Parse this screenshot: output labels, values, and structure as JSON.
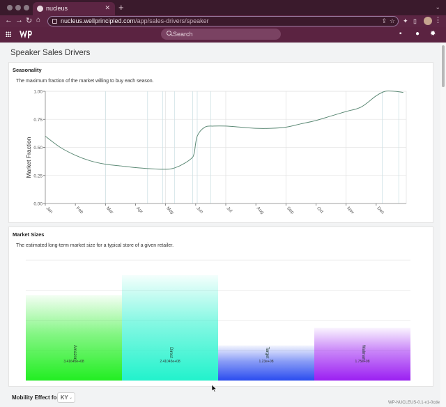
{
  "browser": {
    "tab_title": "nucleus",
    "url_host": "nucleus.wellprincipled.com",
    "url_path": "/app/sales-drivers/speaker"
  },
  "app": {
    "search_placeholder": "Search"
  },
  "page": {
    "title": "Speaker Sales Drivers"
  },
  "seasonality": {
    "title": "Seasonality",
    "description": "The maximum fraction of the market willing to buy each season.",
    "chart_data": {
      "type": "line",
      "ylabel": "Market Fraction",
      "ylim": [
        0,
        1
      ],
      "y_ticks": [
        "0.00",
        "0.25",
        "0.50",
        "0.75",
        "1.00"
      ],
      "x_ticks": [
        "Jan",
        "Feb",
        "Mar",
        "Apr",
        "May",
        "Jun",
        "Jul",
        "Aug",
        "Sep",
        "Oct",
        "Nov",
        "Dec"
      ],
      "x": [
        0,
        0.5,
        1,
        1.5,
        2,
        2.5,
        3,
        3.5,
        3.9,
        4.2,
        4.5,
        4.85,
        4.95,
        5.05,
        5.3,
        5.6,
        6,
        6.5,
        7,
        7.5,
        8,
        8.5,
        9,
        9.5,
        10,
        10.5,
        11,
        11.3,
        11.6,
        11.9
      ],
      "y": [
        0.6,
        0.5,
        0.43,
        0.38,
        0.35,
        0.335,
        0.32,
        0.31,
        0.305,
        0.31,
        0.34,
        0.4,
        0.45,
        0.6,
        0.68,
        0.69,
        0.69,
        0.68,
        0.67,
        0.67,
        0.68,
        0.71,
        0.74,
        0.78,
        0.82,
        0.86,
        0.96,
        1.0,
        1.0,
        0.99
      ]
    }
  },
  "market_sizes": {
    "title": "Market Sizes",
    "description": "The estimated long-term market size for a typical store of a given retailer.",
    "chart_data": {
      "type": "bar",
      "categories": [
        "Amazon",
        "Direct",
        "Target",
        "Walmart"
      ],
      "value_labels": [
        "3.41645e+08",
        "2.41045e+08",
        "1.23e+08",
        "1.75e+08"
      ],
      "values": [
        3.41,
        4.2,
        1.4,
        2.1
      ],
      "ylim": [
        0,
        5
      ],
      "colors": [
        "#22ee22",
        "#22f2cc",
        "#2a4cef",
        "#9b1ff2"
      ]
    }
  },
  "mobility": {
    "label": "Mobility Effect for",
    "selected": "KY"
  },
  "footer": {
    "version": "WP-NUCLEUS-0.1-v1-0cde"
  }
}
